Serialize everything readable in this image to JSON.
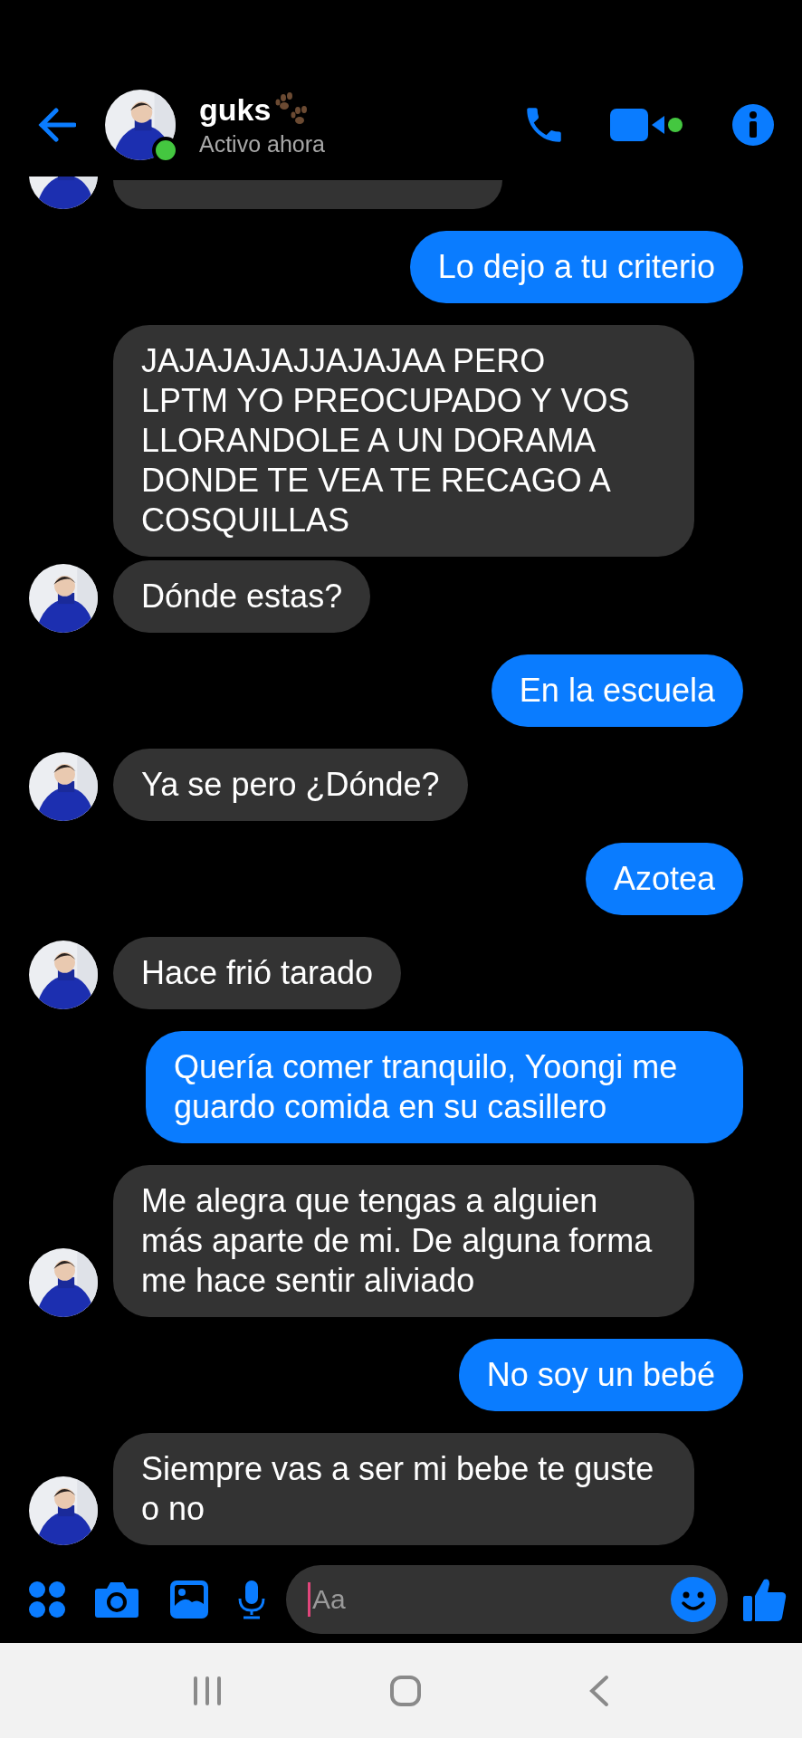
{
  "header": {
    "name": "guks",
    "status": "Activo ahora",
    "online": true
  },
  "messages": [
    {
      "kind": "incoming_cut"
    },
    {
      "kind": "outgoing",
      "text": "Lo dejo a tu criterio"
    },
    {
      "kind": "incoming",
      "text": "JAJAJAJAJJAJAJAA PERO\nLPTM YO PREOCUPADO Y VOS LLORANDOLE A UN DORAMA DONDE TE VEA TE RECAGO A COSQUILLAS"
    },
    {
      "kind": "incoming",
      "text": "Dónde estas?"
    },
    {
      "kind": "outgoing",
      "text": "En la escuela"
    },
    {
      "kind": "incoming",
      "text": "Ya se pero ¿Dónde?"
    },
    {
      "kind": "outgoing",
      "text": "Azotea"
    },
    {
      "kind": "incoming",
      "text": "Hace frió tarado"
    },
    {
      "kind": "outgoing",
      "text": "Quería comer tranquilo, Yoongi me guardo comida en su casillero"
    },
    {
      "kind": "incoming",
      "text": "Me alegra que tengas a alguien más aparte de mi. De alguna forma me hace sentir aliviado"
    },
    {
      "kind": "outgoing",
      "text": "No soy un bebé"
    },
    {
      "kind": "incoming",
      "text": "Siempre vas a ser mi bebe te guste o no"
    }
  ],
  "composer": {
    "placeholder": "Aa"
  }
}
